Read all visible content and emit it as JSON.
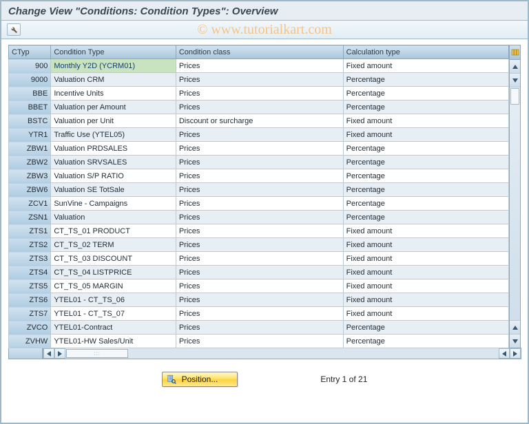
{
  "title": "Change View \"Conditions: Condition Types\": Overview",
  "watermark": "© www.tutorialkart.com",
  "columns": {
    "ctyp": "CTyp",
    "name": "Condition Type",
    "class": "Condition class",
    "calc": "Calculation type"
  },
  "rows": [
    {
      "ctyp": "900",
      "name": "Monthly Y2D (YCRM01)",
      "class": "Prices",
      "calc": "Fixed amount",
      "selected": true
    },
    {
      "ctyp": "9000",
      "name": "Valuation CRM",
      "class": "Prices",
      "calc": "Percentage"
    },
    {
      "ctyp": "BBE",
      "name": "Incentive Units",
      "class": "Prices",
      "calc": "Percentage"
    },
    {
      "ctyp": "BBET",
      "name": "Valuation per Amount",
      "class": "Prices",
      "calc": "Percentage"
    },
    {
      "ctyp": "BSTC",
      "name": "Valuation per Unit",
      "class": "Discount or surcharge",
      "calc": "Fixed amount"
    },
    {
      "ctyp": "YTR1",
      "name": "Traffic Use (YTEL05)",
      "class": "Prices",
      "calc": "Fixed amount"
    },
    {
      "ctyp": "ZBW1",
      "name": "Valuation PRDSALES",
      "class": "Prices",
      "calc": "Percentage"
    },
    {
      "ctyp": "ZBW2",
      "name": "Valuation SRVSALES",
      "class": "Prices",
      "calc": "Percentage"
    },
    {
      "ctyp": "ZBW3",
      "name": "Valuation S/P RATIO",
      "class": "Prices",
      "calc": "Percentage"
    },
    {
      "ctyp": "ZBW6",
      "name": "Valuation SE TotSale",
      "class": "Prices",
      "calc": "Percentage"
    },
    {
      "ctyp": "ZCV1",
      "name": "SunVine - Campaigns",
      "class": "Prices",
      "calc": "Percentage"
    },
    {
      "ctyp": "ZSN1",
      "name": "Valuation",
      "class": "Prices",
      "calc": "Percentage"
    },
    {
      "ctyp": "ZTS1",
      "name": "CT_TS_01 PRODUCT",
      "class": "Prices",
      "calc": "Fixed amount"
    },
    {
      "ctyp": "ZTS2",
      "name": "CT_TS_02 TERM",
      "class": "Prices",
      "calc": "Fixed amount"
    },
    {
      "ctyp": "ZTS3",
      "name": "CT_TS_03 DISCOUNT",
      "class": "Prices",
      "calc": "Fixed amount"
    },
    {
      "ctyp": "ZTS4",
      "name": "CT_TS_04 LISTPRICE",
      "class": "Prices",
      "calc": "Fixed amount"
    },
    {
      "ctyp": "ZTS5",
      "name": "CT_TS_05 MARGIN",
      "class": "Prices",
      "calc": "Fixed amount"
    },
    {
      "ctyp": "ZTS6",
      "name": "YTEL01 - CT_TS_06",
      "class": "Prices",
      "calc": "Fixed amount"
    },
    {
      "ctyp": "ZTS7",
      "name": "YTEL01 - CT_TS_07",
      "class": "Prices",
      "calc": "Fixed amount"
    },
    {
      "ctyp": "ZVCO",
      "name": "YTEL01-Contract",
      "class": "Prices",
      "calc": "Percentage"
    },
    {
      "ctyp": "ZVHW",
      "name": "YTEL01-HW Sales/Unit",
      "class": "Prices",
      "calc": "Percentage"
    }
  ],
  "footer": {
    "position_label": "Position...",
    "entry_text": "Entry 1 of 21"
  }
}
